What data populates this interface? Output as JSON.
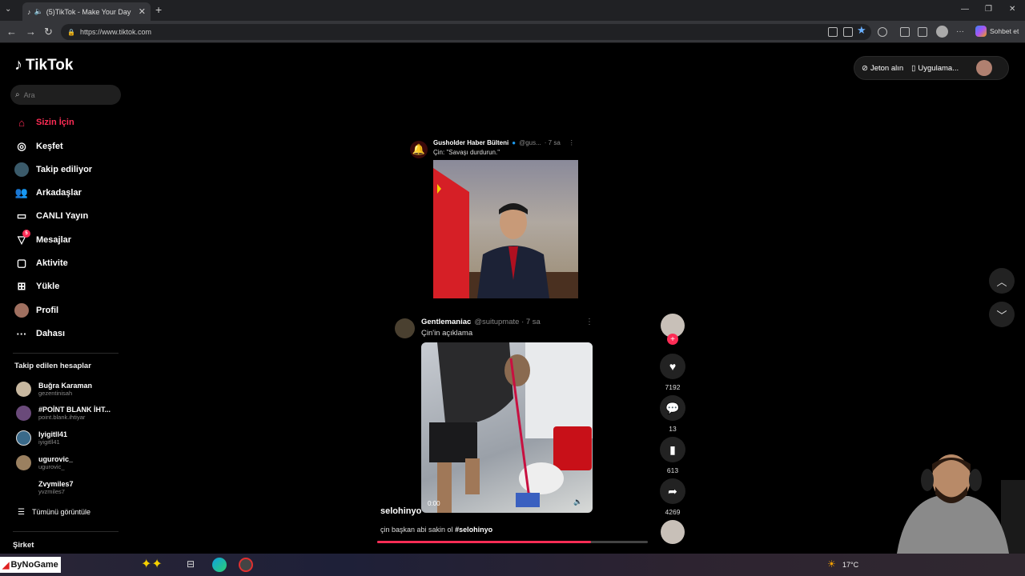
{
  "browser": {
    "tab_title": "(5)TikTok - Make Your Day",
    "url": "https://www.tiktok.com",
    "copilot_label": "Sohbet et"
  },
  "sidebar": {
    "logo": "TikTok",
    "search_placeholder": "Ara",
    "nav": [
      {
        "label": "Sizin İçin",
        "icon": "home-icon"
      },
      {
        "label": "Keşfet",
        "icon": "compass-icon"
      },
      {
        "label": "Takip ediliyor",
        "icon": "following-icon"
      },
      {
        "label": "Arkadaşlar",
        "icon": "friends-icon"
      },
      {
        "label": "CANLI Yayın",
        "icon": "live-icon"
      },
      {
        "label": "Mesajlar",
        "icon": "messages-icon",
        "badge": "5"
      },
      {
        "label": "Aktivite",
        "icon": "activity-icon"
      },
      {
        "label": "Yükle",
        "icon": "upload-icon"
      },
      {
        "label": "Profil",
        "icon": "profile-icon"
      },
      {
        "label": "Dahası",
        "icon": "more-icon"
      }
    ],
    "following_header": "Takip edilen hesaplar",
    "following": [
      {
        "name": "Buğra Karaman",
        "handle": "gezentinisah"
      },
      {
        "name": "#POİNT BLANK İHT...",
        "handle": "point.blank.ihtiyar"
      },
      {
        "name": "Iyigitll41",
        "handle": "iyigitll41"
      },
      {
        "name": "ugurovic_",
        "handle": "ugurovic_"
      },
      {
        "name": "Zvymiles7",
        "handle": "yvzmiles7"
      }
    ],
    "see_all": "Tümünü görüntüle",
    "company": "Şirket"
  },
  "topright": {
    "coins": "Jeton alın",
    "app": "Uygulama..."
  },
  "post": {
    "tweet1": {
      "author": "Gusholder Haber Bülteni",
      "handle": "@gus...",
      "time": "· 7 sa",
      "text": "Çin: \"Savaşı durdurun.\""
    },
    "tweet2": {
      "author": "Gentlemaniac",
      "handle": "@suitupmate · 7 sa",
      "text": "Çin'in açıklama"
    },
    "video_time": "0:00",
    "username": "selohinyo",
    "caption": "çin başkan abi sakin ol",
    "hashtag": "#selohinyo",
    "progress": 0.79
  },
  "actions": {
    "likes": "7192",
    "comments": "13",
    "saves": "613",
    "shares": "4269"
  },
  "taskbar": {
    "brand": "ByNoGame",
    "weather": "17°C"
  },
  "colors": {
    "accent": "#fe2c55",
    "background": "#000000"
  }
}
